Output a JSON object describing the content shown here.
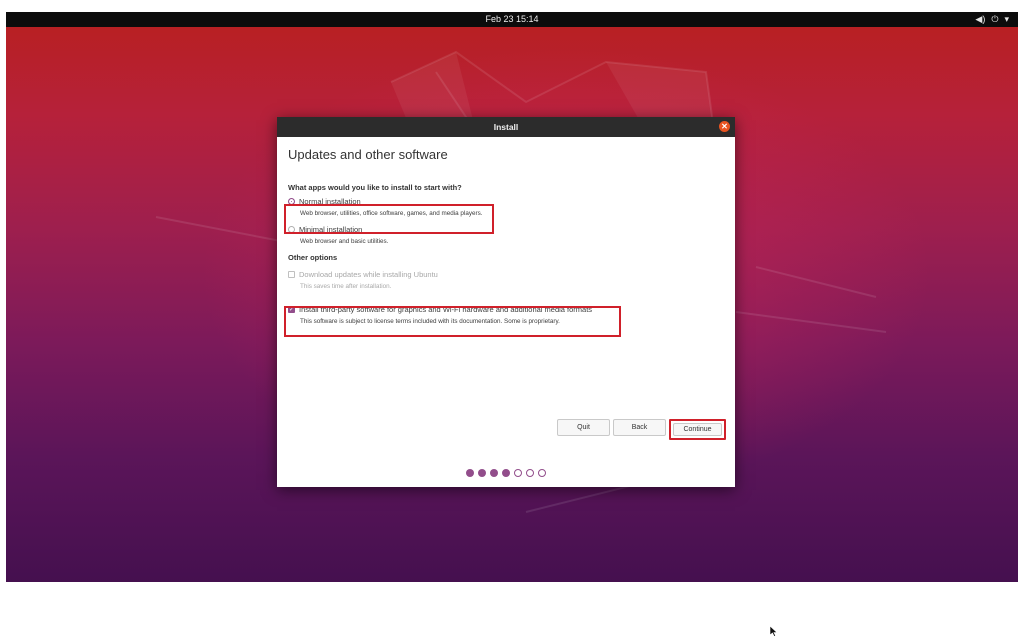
{
  "topbar": {
    "clock": "Feb 23  15:14",
    "tray": {
      "volume_icon": "volume-icon",
      "power_icon": "power-icon",
      "menu_icon": "chevron-down-icon"
    }
  },
  "window": {
    "title": "Install",
    "close_icon": "close-icon",
    "page_title": "Updates and other software",
    "question": "What apps would you like to install to start with?",
    "options": {
      "normal": {
        "label": "Normal installation",
        "desc": "Web browser, utilities, office software, games, and media players.",
        "selected": true
      },
      "minimal": {
        "label": "Minimal installation",
        "desc": "Web browser and basic utilities.",
        "selected": false
      }
    },
    "other_options_heading": "Other options",
    "download_updates": {
      "label": "Download updates while installing Ubuntu",
      "desc": "This saves time after installation.",
      "checked": false,
      "enabled": false
    },
    "third_party": {
      "label": "Install third-party software for graphics and Wi-Fi hardware and additional media formats",
      "desc": "This software is subject to license terms included with its documentation. Some is proprietary.",
      "checked": true
    },
    "buttons": {
      "quit": "Quit",
      "back": "Back",
      "continue": "Continue"
    },
    "progress": {
      "total": 7,
      "completed": 4
    }
  },
  "colors": {
    "accent": "#924d8b",
    "highlight": "#d0202a",
    "close": "#e95420",
    "titlebar": "#2c2c2c"
  }
}
